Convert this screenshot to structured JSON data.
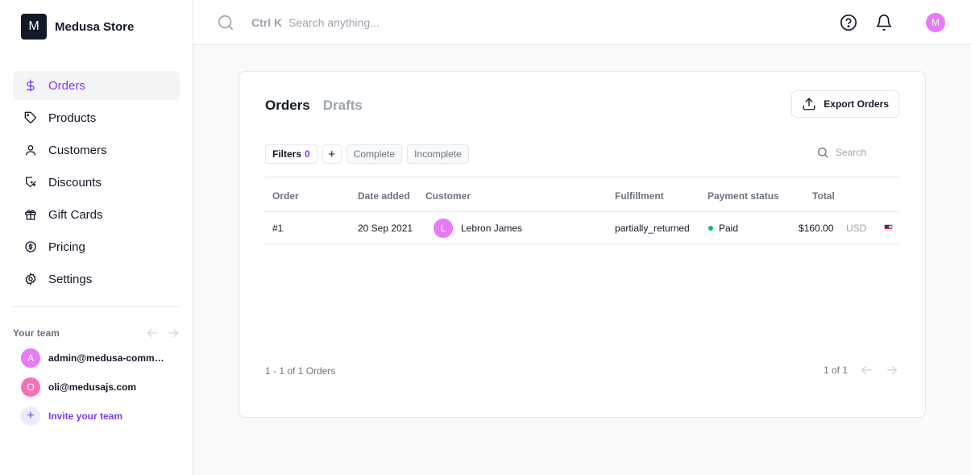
{
  "store": {
    "logo_letter": "M",
    "name": "Medusa Store"
  },
  "nav": {
    "items": [
      {
        "label": "Orders",
        "icon": "dollar-icon",
        "active": true
      },
      {
        "label": "Products",
        "icon": "tag-icon"
      },
      {
        "label": "Customers",
        "icon": "user-icon"
      },
      {
        "label": "Discounts",
        "icon": "discount-icon"
      },
      {
        "label": "Gift Cards",
        "icon": "gift-icon"
      },
      {
        "label": "Pricing",
        "icon": "pricing-icon"
      },
      {
        "label": "Settings",
        "icon": "gear-icon"
      }
    ]
  },
  "team": {
    "label": "Your team",
    "members": [
      {
        "initial": "A",
        "email": "admin@medusa-commerce.com",
        "color": "#e879f9"
      },
      {
        "initial": "O",
        "email": "oli@medusajs.com",
        "color": "#f472b6"
      }
    ],
    "invite_label": "Invite your team"
  },
  "topbar": {
    "shortcut": "Ctrl K",
    "search_placeholder": "Search anything...",
    "user_initial": "M"
  },
  "orders": {
    "tabs": [
      "Orders",
      "Drafts"
    ],
    "export_label": "Export Orders",
    "filters": {
      "label": "Filters",
      "count": "0",
      "plus": "+",
      "presets": [
        "Complete",
        "Incomplete"
      ]
    },
    "search_placeholder": "Search",
    "columns": [
      "Order",
      "Date added",
      "Customer",
      "Fulfillment",
      "Payment status",
      "Total"
    ],
    "rows": [
      {
        "order": "#1",
        "date": "20 Sep 2021",
        "customer_initial": "L",
        "customer": "Lebron James",
        "fulfillment": "partially_returned",
        "payment_status": "Paid",
        "total": "$160.00",
        "currency": "USD"
      }
    ],
    "pagination_info": "1 - 1 of 1 Orders",
    "page": "1 of 1"
  },
  "colors": {
    "accent": "#7c3aed",
    "avatar": "#e879f9",
    "paid": "#10b981"
  }
}
